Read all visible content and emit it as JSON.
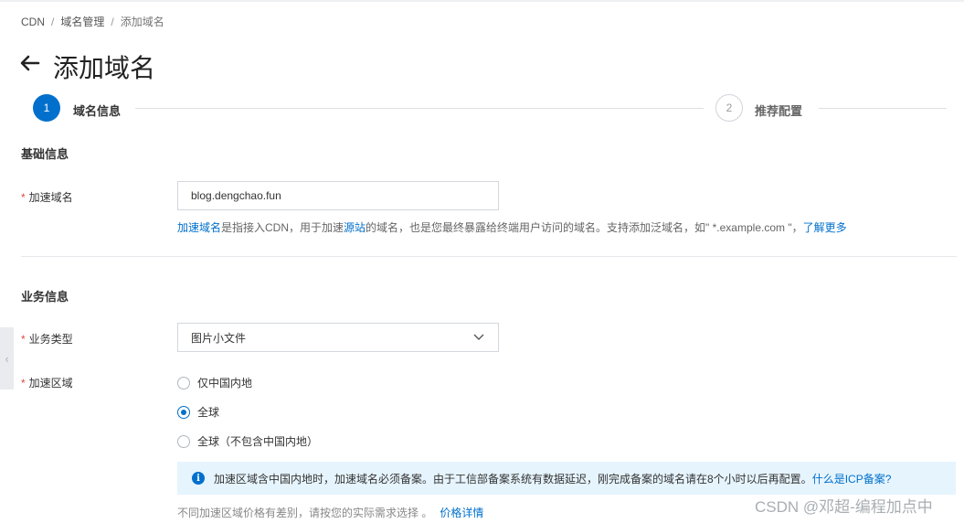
{
  "breadcrumb": [
    "CDN",
    "域名管理",
    "添加域名"
  ],
  "page_title": "添加域名",
  "steps": [
    {
      "number": "1",
      "label": "域名信息"
    },
    {
      "number": "2",
      "label": "推荐配置"
    }
  ],
  "sections": {
    "basic": "基础信息",
    "business": "业务信息"
  },
  "domain_field": {
    "label": "加速域名",
    "value": "blog.dengchao.fun",
    "help_link": "加速域名",
    "help_text_1": "是指接入CDN，用于加速",
    "help_link_2": "源站",
    "help_text_2": "的域名，也是您最终暴露给终端用户访问的域名。支持添加泛域名，如\" *.example.com \"，",
    "learn_more": "了解更多"
  },
  "business_type": {
    "label": "业务类型",
    "selected": "图片小文件"
  },
  "region": {
    "label": "加速区域",
    "options": [
      "仅中国内地",
      "全球",
      "全球（不包含中国内地）"
    ],
    "selected_index": 1
  },
  "notice": {
    "text": "加速区域含中国内地时，加速域名必须备案。由于工信部备案系统有数据延迟，刚完成备案的域名请在8个小时以后再配置。",
    "link": "什么是ICP备案?"
  },
  "price_note": {
    "text": "不同加速区域价格有差别，请按您的实际需求选择 。",
    "link": "价格详情"
  },
  "watermark": "CSDN @邓超-编程加点中",
  "colors": {
    "primary": "#0070cc",
    "required": "#e0493d",
    "notice_bg": "#e6f4fd"
  }
}
